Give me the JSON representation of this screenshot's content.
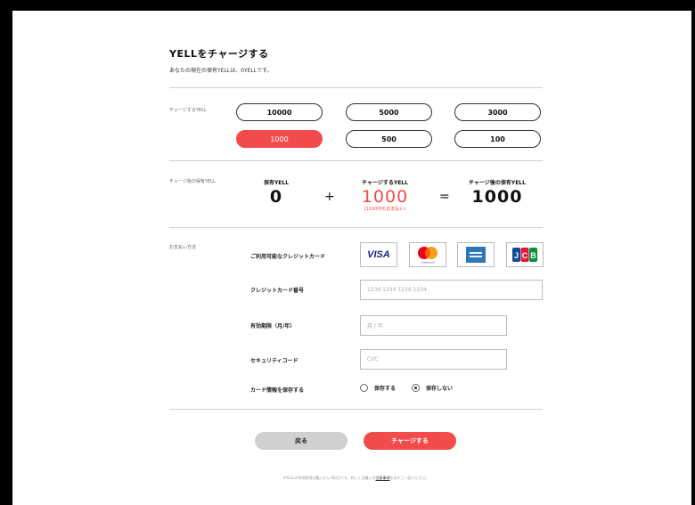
{
  "header": {
    "title": "YELLをチャージする",
    "subtitle": "あなたの現在の保有YELLは、0YELLです。"
  },
  "charge_section": {
    "label": "チャージするYELL",
    "options": [
      "10000",
      "5000",
      "3000",
      "1000",
      "500",
      "100"
    ],
    "selected": "1000"
  },
  "after_section": {
    "label": "チャージ後の保有YELL",
    "current_label": "保有YELL",
    "current_value": "0",
    "plus": "+",
    "charge_label": "チャージするYELL",
    "charge_value": "1000",
    "charge_note": "(1100円のお支払い)",
    "equals": "=",
    "after_label": "チャージ後の保有YELL",
    "after_value": "1000"
  },
  "payment": {
    "label": "お支払い方法",
    "cards_label": "ご利用可能なクレジットカード",
    "cards": [
      "VISA",
      "mastercard",
      "American Express",
      "JCB"
    ],
    "card_number_label": "クレジットカード番号",
    "card_number_placeholder": "1234 1234 1234 1234",
    "expiry_label": "有効期限（月/年）",
    "expiry_placeholder": "月 / 年",
    "cvc_label": "セキュリティコード",
    "cvc_placeholder": "CVC",
    "save_label": "カード情報を保存する",
    "save_yes": "保存する",
    "save_no": "保存しない",
    "save_selected": "保存しない"
  },
  "actions": {
    "back": "戻る",
    "charge": "チャージする"
  },
  "footer": {
    "note_before": "※YELLの利用期限は購入から180日です。詳しくは購入の",
    "note_link": "注意事項",
    "note_after": "を必ずご一読ください。"
  },
  "colors": {
    "accent": "#f14b4b",
    "secondary_button": "#d0d0d0"
  }
}
